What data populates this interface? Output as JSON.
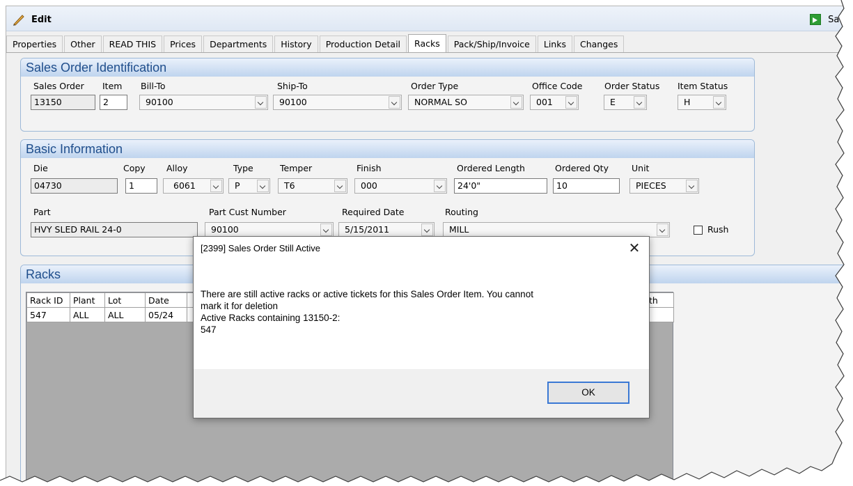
{
  "toolbar": {
    "edit_label": "Edit",
    "save_label": "Save"
  },
  "tabs": [
    {
      "label": "Properties"
    },
    {
      "label": "Other"
    },
    {
      "label": "READ THIS"
    },
    {
      "label": "Prices"
    },
    {
      "label": "Departments"
    },
    {
      "label": "History"
    },
    {
      "label": "Production Detail"
    },
    {
      "label": "Racks"
    },
    {
      "label": "Pack/Ship/Invoice"
    },
    {
      "label": "Links"
    },
    {
      "label": "Changes"
    }
  ],
  "active_tab": "Racks",
  "sales_order_identification": {
    "title": "Sales Order Identification",
    "labels": {
      "sales_order": "Sales Order",
      "item": "Item",
      "bill_to": "Bill-To",
      "ship_to": "Ship-To",
      "order_type": "Order Type",
      "office_code": "Office Code",
      "order_status": "Order Status",
      "item_status": "Item Status"
    },
    "values": {
      "sales_order": "13150",
      "item": "2",
      "bill_to": "90100",
      "ship_to": "90100",
      "order_type": "NORMAL SO",
      "office_code": "001",
      "order_status": "E",
      "item_status": "H"
    }
  },
  "basic_information": {
    "title": "Basic Information",
    "labels": {
      "die": "Die",
      "copy": "Copy",
      "alloy": "Alloy",
      "type": "Type",
      "temper": "Temper",
      "finish": "Finish",
      "ordered_length": "Ordered Length",
      "ordered_qty": "Ordered Qty",
      "unit": "Unit",
      "part": "Part",
      "part_cust_number": "Part Cust Number",
      "required_date": "Required Date",
      "routing": "Routing",
      "rush": "Rush"
    },
    "values": {
      "die": "04730",
      "copy": "1",
      "alloy": "6061",
      "type": "P",
      "temper": "T6",
      "finish": "000",
      "ordered_length": "24'0\"",
      "ordered_qty": "10",
      "unit": "PIECES",
      "part": "HVY SLED RAIL 24-0",
      "part_cust_number": "90100",
      "required_date": "5/15/2011",
      "routing": "MILL"
    },
    "rush_checked": false
  },
  "racks": {
    "title": "Racks",
    "columns": [
      "Rack ID",
      "Plant",
      "Lot",
      "Date",
      "",
      "",
      "",
      "",
      "",
      "",
      "",
      "",
      "",
      "",
      "",
      "th"
    ],
    "rows": [
      [
        "547",
        "ALL",
        "ALL",
        "05/24",
        "",
        "",
        "",
        "",
        "",
        "",
        "",
        "",
        "",
        "",
        "",
        ""
      ]
    ]
  },
  "dialog": {
    "title": "[2399] Sales Order Still Active",
    "message_line1": "There are still active racks or active tickets for this Sales Order Item. You cannot",
    "message_line2": "mark it for deletion",
    "message_line3": "Active Racks containing 13150-2:",
    "message_line4": "547",
    "ok_label": "OK"
  },
  "colors": {
    "group_header_text": "#1f4e8c",
    "dialog_button_border": "#3a78d4"
  },
  "icons": {
    "edit": "pencil-icon",
    "save": "save-arrow-icon",
    "close": "close-icon"
  }
}
